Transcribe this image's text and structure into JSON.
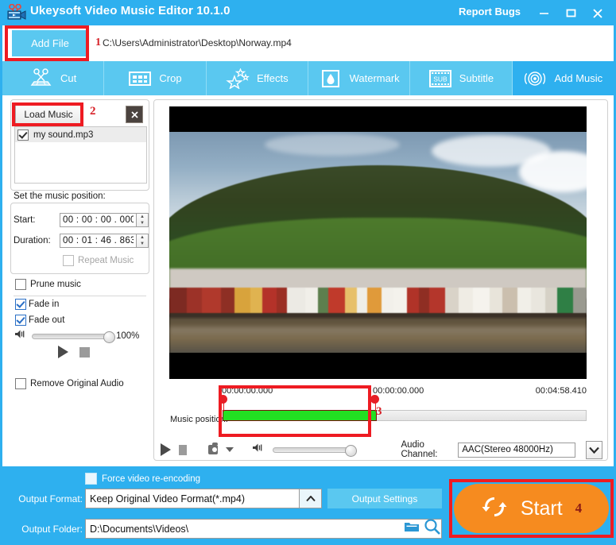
{
  "window": {
    "title": "Ukeysoft Video Music Editor 10.1.0",
    "report_bugs": "Report Bugs",
    "app_icon": "movie-camera-icon",
    "minimize": "minimize-icon",
    "maximize": "maximize-icon",
    "close": "close-icon",
    "accent": "#2eb0ef",
    "accent_light": "#5ac8f0",
    "annotation_color": "#ee1b22"
  },
  "filebar": {
    "add_file_label": "Add File",
    "file_path": "C:\\Users\\Administrator\\Desktop\\Norway.mp4",
    "annotation": "1"
  },
  "tabs": [
    {
      "label": "Cut",
      "icon": "scissors-icon",
      "active": false
    },
    {
      "label": "Crop",
      "icon": "crop-frame-icon",
      "active": false
    },
    {
      "label": "Effects",
      "icon": "stars-icon",
      "active": false
    },
    {
      "label": "Watermark",
      "icon": "droplet-icon",
      "active": false
    },
    {
      "label": "Subtitle",
      "icon": "subtitle-film-icon",
      "active": false
    },
    {
      "label": "Add Music",
      "icon": "audio-disc-icon",
      "active": true
    }
  ],
  "music_panel": {
    "load_music_label": "Load Music",
    "annotation": "2",
    "close_icon": "close-icon",
    "tracks": [
      {
        "name": "my sound.mp3",
        "checked": true
      }
    ],
    "position_title": "Set the music position:",
    "start_label": "Start:",
    "start_value": "00 : 00 : 00 . 000",
    "duration_label": "Duration:",
    "duration_value": "00 : 01 : 46 . 863",
    "repeat_music_label": "Repeat Music",
    "repeat_music_checked": false,
    "repeat_music_enabled": false,
    "prune_music_label": "Prune music",
    "prune_music_checked": false,
    "fade_in_label": "Fade in",
    "fade_in_checked": true,
    "fade_out_label": "Fade out",
    "fade_out_checked": true,
    "volume_percent": "100%",
    "volume_icon": "speaker-icon",
    "play_icon": "play-icon",
    "stop_icon": "stop-icon",
    "remove_original_audio_label": "Remove Original Audio",
    "remove_original_audio_checked": false
  },
  "preview": {
    "timeline": {
      "time_left": "00:00:00.000",
      "time_middle": "00:00:00.000",
      "time_right": "00:04:58.410",
      "music_position_label": "Music position:",
      "annotation": "3",
      "selection_color": "#22e022"
    },
    "controls": {
      "play_icon": "play-icon",
      "stop_icon": "stop-icon",
      "snapshot_icon": "camera-icon",
      "snapshot_menu_icon": "chevron-down-icon",
      "volume_icon": "speaker-icon",
      "audio_channel_label": "Audio Channel:",
      "audio_channel_value": "AAC(Stereo 48000Hz)",
      "audio_channel_arrow": "chevron-down-icon"
    }
  },
  "output": {
    "force_reencode_label": "Force video re-encoding",
    "force_reencode_checked": false,
    "format_label": "Output Format:",
    "format_value": "Keep Original Video Format(*.mp4)",
    "format_arrow": "chevron-up-icon",
    "settings_button": "Output Settings",
    "folder_label": "Output Folder:",
    "folder_value": "D:\\Documents\\Videos\\",
    "folder_icon": "folder-icon",
    "search_icon": "search-icon",
    "start_label": "Start",
    "start_icon": "refresh-convert-icon",
    "start_annotation": "4",
    "start_color": "#f68b1f"
  }
}
